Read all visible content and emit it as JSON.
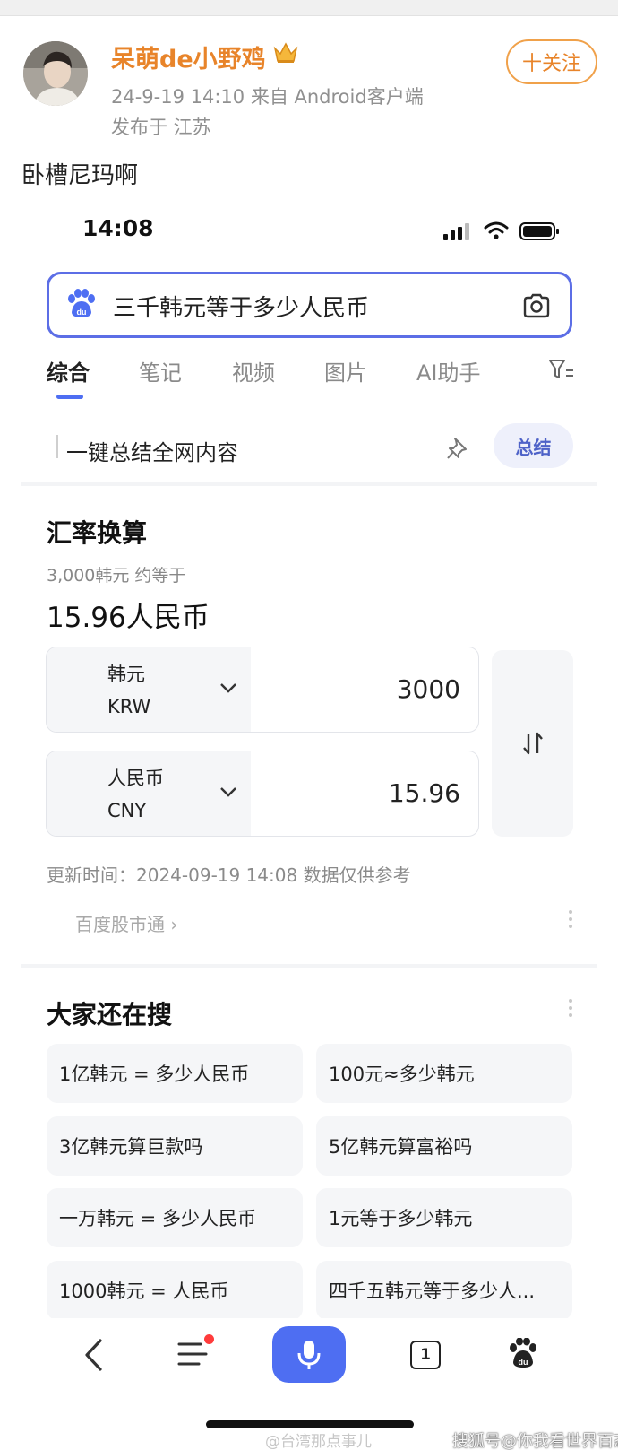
{
  "weibo": {
    "username": "呆萌de小野鸡",
    "meta": "24-9-19 14:10  来自 Android客户端",
    "location": "发布于 江苏",
    "follow_label": "十关注",
    "post_text": "卧槽尼玛啊"
  },
  "phone": {
    "status_time": "14:08",
    "search": {
      "query": "三千韩元等于多少人民币"
    },
    "tabs": [
      {
        "label": "综合",
        "active": true
      },
      {
        "label": "笔记"
      },
      {
        "label": "视频"
      },
      {
        "label": "图片"
      },
      {
        "label": "AI助手"
      }
    ],
    "summary": {
      "text": "一键总结全网内容",
      "button": "总结"
    },
    "converter": {
      "title": "汇率换算",
      "subtitle": "3,000韩元 约等于",
      "result": "15.96人民币",
      "from": {
        "name": "韩元",
        "code": "KRW",
        "amount": "3000"
      },
      "to": {
        "name": "人民币",
        "code": "CNY",
        "amount": "15.96"
      },
      "update_time": "更新时间：2024-09-19 14:08 数据仅供参考",
      "source": "百度股市通 ›"
    },
    "related": {
      "title": "大家还在搜",
      "items": [
        "1亿韩元 = 多少人民币",
        "100元≈多少韩元",
        "3亿韩元算巨款吗",
        "5亿韩元算富裕吗",
        "一万韩元 = 多少人民币",
        "1元等于多少韩元",
        "1000韩元 = 人民币",
        "四千五韩元等于多少人..."
      ]
    },
    "bottom_nav": {
      "window_count": "1"
    }
  },
  "watermarks": {
    "left": "@台湾那点事儿",
    "right": "搜狐号@你我看世界百态"
  },
  "colors": {
    "accent": "#4e6ef2",
    "weibo_orange": "#e8842a",
    "notification": "#ff3b3b"
  }
}
